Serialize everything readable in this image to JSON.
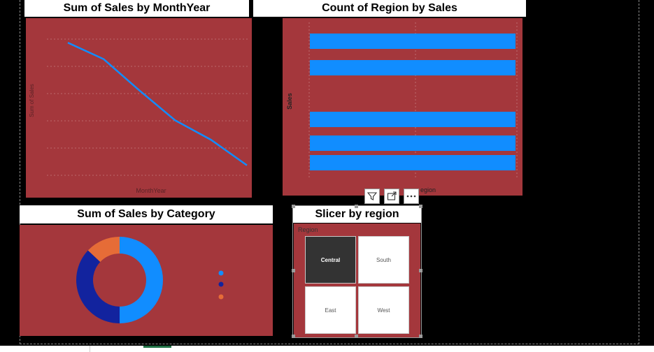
{
  "line_visual": {
    "title": "Sum of Sales by MonthYear",
    "xlabel": "MonthYear",
    "ylabel": "Sum of Sales"
  },
  "bar_visual": {
    "title": "Count of Region by Sales",
    "ylabel": "Sales",
    "xlabel_partial": "egion"
  },
  "donut_visual": {
    "title": "Sum of Sales by Category"
  },
  "slicer": {
    "title": "Slicer by region",
    "header": "Region",
    "options": [
      "Central",
      "South",
      "East",
      "West"
    ],
    "selected": "Central"
  },
  "visual_header_icons": [
    "filter-icon",
    "focus-mode-icon",
    "more-options-icon"
  ],
  "colors": {
    "plot_bg": "#a4373c",
    "line": "#118dff",
    "bar": "#118dff",
    "donut": [
      "#118dff",
      "#12239e",
      "#e66c37"
    ],
    "slicer_selected": "#333333"
  },
  "chart_data": [
    {
      "type": "line",
      "title": "Sum of Sales by MonthYear",
      "xlabel": "MonthYear",
      "ylabel": "Sum of Sales",
      "series": [
        {
          "values": [
            0.92,
            0.81,
            0.6,
            0.4,
            0.27,
            0.1
          ]
        }
      ],
      "grid": true
    },
    {
      "type": "bar",
      "orientation": "horizontal",
      "title": "Count of Region by Sales",
      "ylabel": "Sales",
      "values": [
        1,
        1,
        null,
        1,
        1,
        1
      ],
      "grid": true
    },
    {
      "type": "pie",
      "donut": true,
      "title": "Sum of Sales by Category",
      "values": [
        50,
        37,
        13
      ],
      "legend_placement": "right"
    }
  ]
}
